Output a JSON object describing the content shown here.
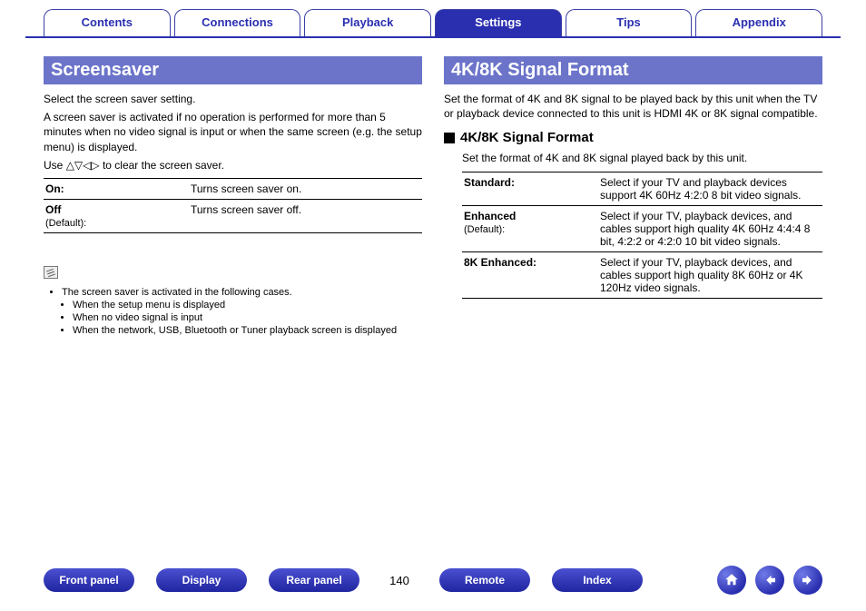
{
  "tabs": [
    "Contents",
    "Connections",
    "Playback",
    "Settings",
    "Tips",
    "Appendix"
  ],
  "activeTab": "Settings",
  "left": {
    "title": "Screensaver",
    "p1": "Select the screen saver setting.",
    "p2": "A screen saver is activated if no operation is performed for more than 5 minutes when no video signal is input or when the same screen (e.g. the setup menu) is displayed.",
    "p3_pre": "Use ",
    "p3_post": " to clear the screen saver.",
    "rows": [
      {
        "label": "On:",
        "sub": "",
        "desc": "Turns screen saver on."
      },
      {
        "label": "Off",
        "sub": "(Default):",
        "desc": "Turns screen saver off."
      }
    ],
    "noteIntro": "The screen saver is activated in the following cases.",
    "noteItems": [
      "When the setup menu is displayed",
      "When no video signal is input",
      "When the network, USB, Bluetooth or Tuner playback screen is displayed"
    ]
  },
  "right": {
    "title": "4K/8K Signal Format",
    "p1": "Set the format of 4K and 8K signal to be played back by this unit when the TV or playback device connected to this unit is HDMI 4K or 8K signal compatible.",
    "subhead": "4K/8K Signal Format",
    "p2": "Set the format of 4K and 8K signal played back by this unit.",
    "rows": [
      {
        "label": "Standard:",
        "sub": "",
        "desc": "Select if your TV and playback devices support 4K 60Hz 4:2:0 8 bit video signals."
      },
      {
        "label": "Enhanced",
        "sub": "(Default):",
        "desc": "Select if your TV, playback devices, and cables support high quality 4K 60Hz 4:4:4 8 bit, 4:2:2 or 4:2:0 10 bit video signals."
      },
      {
        "label": "8K Enhanced:",
        "sub": "",
        "desc": "Select if your TV, playback devices, and cables support high quality 8K 60Hz or 4K 120Hz video signals."
      }
    ]
  },
  "footer": {
    "buttons": [
      "Front panel",
      "Display",
      "Rear panel"
    ],
    "page": "140",
    "buttons2": [
      "Remote",
      "Index"
    ]
  }
}
